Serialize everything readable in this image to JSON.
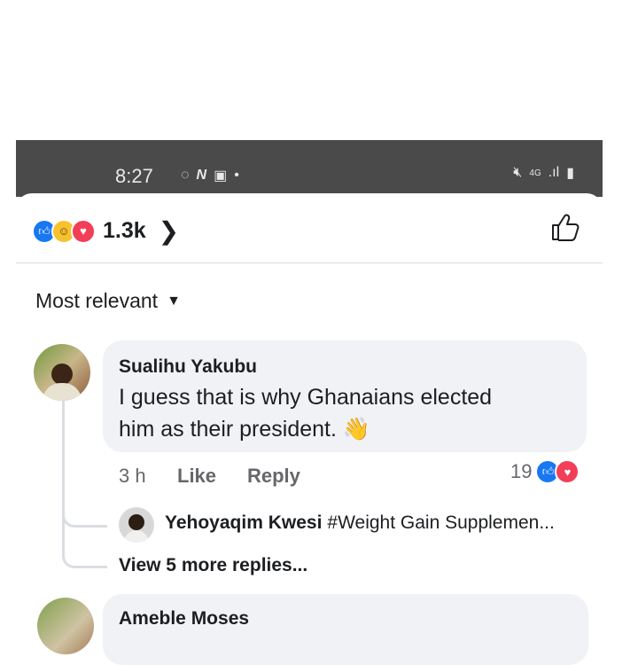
{
  "status_bar": {
    "time": "8:27",
    "network": "4G"
  },
  "reactions": {
    "count": "1.3k"
  },
  "sort": {
    "label": "Most relevant"
  },
  "comments": [
    {
      "name": "Sualihu Yakubu",
      "text_line1": "I guess that is why Ghanaians elected",
      "text_line2": "him as their president.",
      "emoji": "👋",
      "time": "3 h",
      "like_label": "Like",
      "reply_label": "Reply",
      "reaction_count": "19"
    }
  ],
  "reply_preview": {
    "name": "Yehoyaqim Kwesi",
    "text": "#Weight Gain Supplemen..."
  },
  "view_more_label": "View 5 more replies...",
  "second_comment": {
    "name": "Ameble Moses"
  },
  "colors": {
    "like_blue": "#1877f2",
    "love_red": "#f33e58",
    "bubble": "#f0f2f5"
  }
}
